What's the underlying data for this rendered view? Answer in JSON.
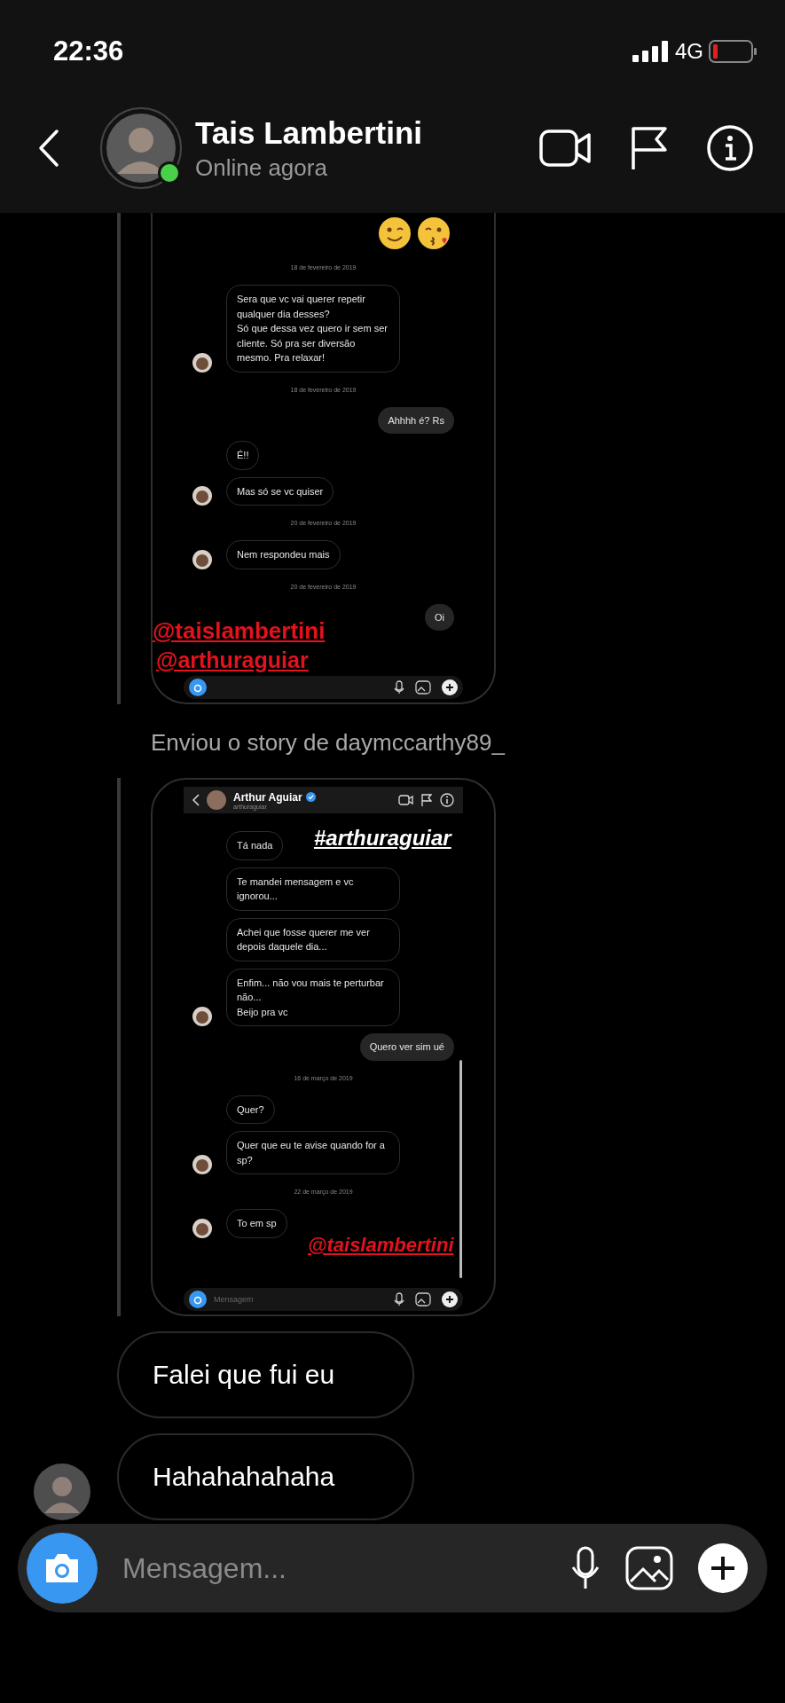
{
  "status_bar": {
    "time": "22:36",
    "network": "4G"
  },
  "header": {
    "name": "Tais Lambertini",
    "status": "Online agora",
    "online": true
  },
  "story_1": {
    "messages": [
      {
        "kind": "emojis"
      },
      {
        "kind": "date",
        "text": "18 de fevereiro de 2019"
      },
      {
        "kind": "received",
        "text": "Sera que vc vai querer repetir qualquer dia desses?\nSó que dessa vez quero ir sem ser cliente. Só pra ser diversão mesmo. Pra relaxar!",
        "avatar": true
      },
      {
        "kind": "date",
        "text": "18 de fevereiro de 2019"
      },
      {
        "kind": "sent",
        "text": "Ahhhh é? Rs"
      },
      {
        "kind": "received",
        "text": "É!!",
        "avatar": false
      },
      {
        "kind": "received",
        "text": "Mas só se vc quiser",
        "avatar": true
      },
      {
        "kind": "date",
        "text": "20 de fevereiro de 2019"
      },
      {
        "kind": "received",
        "text": "Nem respondeu mais",
        "avatar": true
      },
      {
        "kind": "date",
        "text": "20 de fevereiro de 2019"
      },
      {
        "kind": "sent",
        "text": "Oi"
      }
    ],
    "stickers": [
      {
        "text": "@taislambertini",
        "color": "#e3121c"
      },
      {
        "text": "@arthuraguiar",
        "color": "#e3121c"
      }
    ]
  },
  "caption": "Enviou o story de daymccarthy89_",
  "story_2": {
    "header": {
      "name": "Arthur Aguiar",
      "verified": true,
      "username": "arthuraguiar"
    },
    "messages": [
      {
        "kind": "received",
        "text": "Tá nada",
        "avatar": false
      },
      {
        "kind": "received",
        "text": "Te mandei mensagem e vc ignorou...",
        "avatar": false
      },
      {
        "kind": "received",
        "text": "Achei que fosse querer me ver depois daquele dia...",
        "avatar": false
      },
      {
        "kind": "received",
        "text": "Enfim... não vou mais te perturbar não...\nBeijo pra vc",
        "avatar": true
      },
      {
        "kind": "sent",
        "text": "Quero ver sim ué"
      },
      {
        "kind": "date",
        "text": "16 de março de 2019"
      },
      {
        "kind": "received",
        "text": "Quer?",
        "avatar": false
      },
      {
        "kind": "received",
        "text": "Quer que eu te avise quando for a sp?",
        "avatar": true
      },
      {
        "kind": "date",
        "text": "22 de março de 2019"
      },
      {
        "kind": "received",
        "text": "To em sp",
        "avatar": true
      }
    ],
    "stickers": [
      {
        "text": "#arthuraguiar",
        "color": "#ffffff"
      },
      {
        "text": "@taislambertini",
        "color": "#e3121c"
      }
    ],
    "composer": {
      "placeholder": "Mensagem"
    }
  },
  "bubbles": [
    {
      "text": "Falei que fui eu",
      "avatar": false
    },
    {
      "text": "Hahahahahaha",
      "avatar": true
    }
  ],
  "composer": {
    "placeholder": "Mensagem..."
  }
}
